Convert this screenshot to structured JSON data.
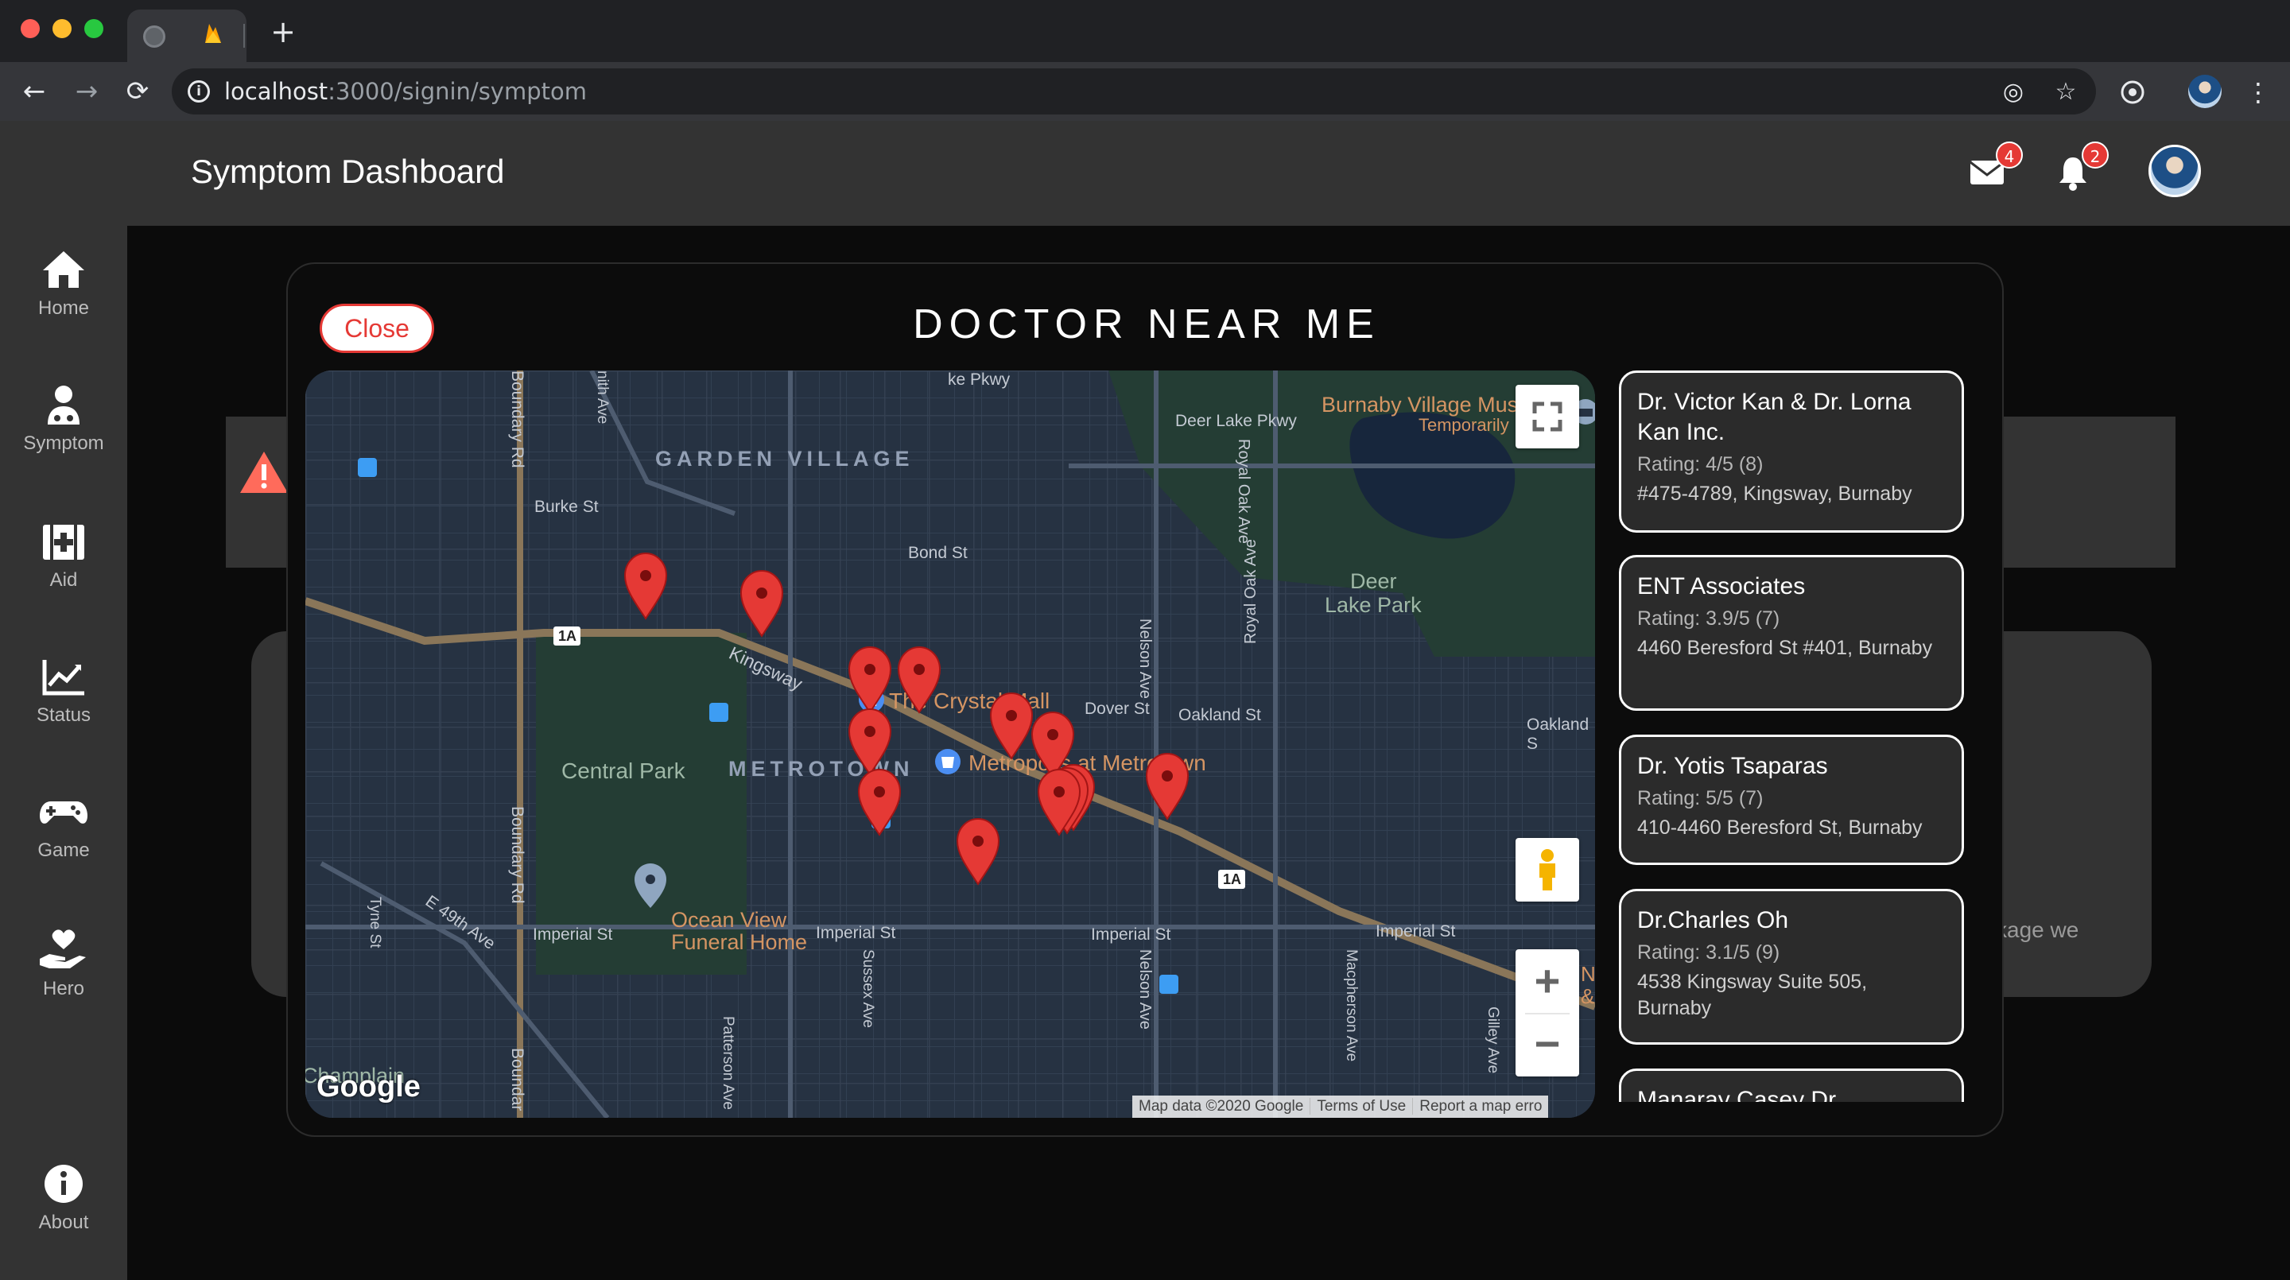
{
  "browser": {
    "url_host": "localhost",
    "url_path": ":3000/signin/symptom"
  },
  "app": {
    "title": "Symptom Dashboard",
    "mail_badge": "4",
    "notification_badge": "2"
  },
  "sidebar": {
    "items": [
      {
        "label": "Home"
      },
      {
        "label": "Symptom"
      },
      {
        "label": "Aid"
      },
      {
        "label": "Status"
      },
      {
        "label": "Game"
      },
      {
        "label": "Hero"
      },
      {
        "label": "About"
      }
    ]
  },
  "background": {
    "partial_text": "kage we"
  },
  "modal": {
    "title": "DOCTOR NEAR ME",
    "close_label": "Close"
  },
  "map": {
    "labels": {
      "garden_village": "GARDEN VILLAGE",
      "metrotown": "METROTOWN",
      "central_park": "Central Park",
      "deer_lake_park_1": "Deer",
      "deer_lake_park_2": "Lake Park",
      "burnaby_village_1": "Burnaby Village Mus",
      "burnaby_village_2": "Temporarily",
      "crystal_mall": "The Crystal Mall",
      "metropolis": "Metropolis at Metrotown",
      "ocean_view_1": "Ocean View",
      "ocean_view_2": "Funeral Home",
      "champlain": "Champlain",
      "deer_lake_pkwy": "Deer Lake Pkwy",
      "lake_pkwy_top": "ke Pkwy",
      "boundary_rd_1": "Boundary Rd",
      "boundary_rd_2": "Boundary Rd",
      "boundary_rd_3": "Boundar",
      "burke_st": "Burke St",
      "bond_st": "Bond St",
      "kingsway": "Kingsway",
      "nelson_ave_1": "Nelson Ave",
      "nelson_ave_2": "Nelson Ave",
      "royal_oak_1": "Royal Oak Ave",
      "royal_oak_2": "Royal Oak Ave",
      "dover_st": "Dover St",
      "oakland_st_1": "Oakland St",
      "oakland_st_2": "Oakland S",
      "imperial_st_1": "Imperial St",
      "imperial_st_2": "Imperial St",
      "imperial_st_3": "Imperial St",
      "imperial_st_4": "Imperial St",
      "tyne_st": "Tyne St",
      "e49th": "E 49th Ave",
      "sussex_ave": "Sussex Ave",
      "patterson_ave": "Patterson Ave",
      "macpherson_ave": "Macpherson Ave",
      "gilley_ave": "Gilley Ave",
      "smith_ave": "nith Ave",
      "route_1a": "1A",
      "edge_n": "N",
      "edge_amp": "&"
    },
    "attribution": [
      "Map data ©2020 Google",
      "Terms of Use",
      "Report a map erro"
    ],
    "logo": "Google"
  },
  "doctors": [
    {
      "name": "Dr. Victor Kan & Dr. Lorna Kan Inc.",
      "rating": "Rating: 4/5 (8)",
      "address": "#475-4789, Kingsway, Burnaby"
    },
    {
      "name": "ENT Associates",
      "rating": "Rating: 3.9/5 (7)",
      "address": "4460 Beresford St #401, Burnaby"
    },
    {
      "name": "Dr. Yotis Tsaparas",
      "rating": "Rating: 5/5 (7)",
      "address": "410-4460 Beresford St, Burnaby"
    },
    {
      "name": "Dr.Charles Oh",
      "rating": "Rating: 3.1/5 (9)",
      "address": "4538 Kingsway Suite 505, Burnaby"
    },
    {
      "name": "Manaray Casey Dr",
      "rating": "",
      "address": ""
    }
  ],
  "colors": {
    "accent_red": "#e53935",
    "map_bg": "#263242",
    "panel_dark": "#333333"
  }
}
